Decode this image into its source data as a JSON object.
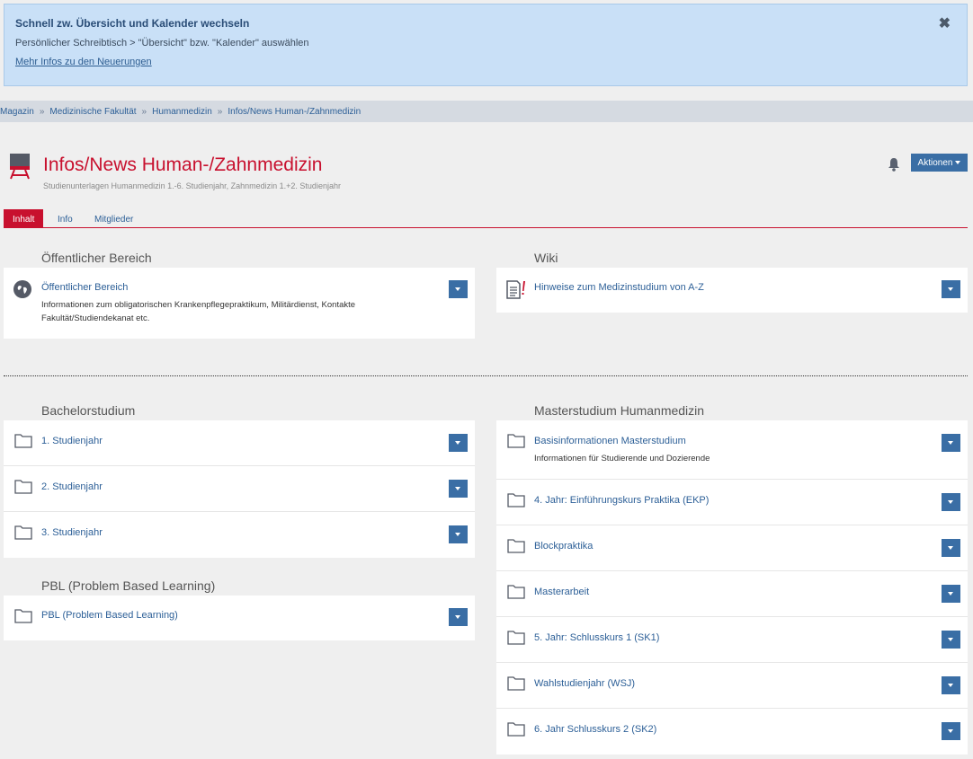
{
  "notice": {
    "title": "Schnell zw. Übersicht und Kalender wechseln",
    "text": "Persönlicher Schreibtisch > \"Übersicht\" bzw. \"Kalender\" auswählen",
    "link": "Mehr Infos zu den Neuerungen",
    "close": "✖"
  },
  "breadcrumb": [
    "Magazin",
    "Medizinische Fakultät",
    "Humanmedizin",
    "Infos/News Human-/Zahnmedizin"
  ],
  "breadcrumb_sep": "»",
  "header": {
    "title": "Infos/News Human-/Zahnmedizin",
    "subtitle": "Studienunterlagen Humanmedizin 1.-6. Studienjahr, Zahnmedizin 1.+2. Studienjahr",
    "actions_label": "Aktionen"
  },
  "tabs": [
    {
      "label": "Inhalt",
      "active": true
    },
    {
      "label": "Info",
      "active": false
    },
    {
      "label": "Mitglieder",
      "active": false
    }
  ],
  "sections": {
    "public": {
      "title": "Öffentlicher Bereich",
      "item_title": "Öffentlicher Bereich",
      "item_desc_1": "Informationen zum obligatorischen Krankenpflegepraktikum, Militärdienst, Kontakte",
      "item_desc_2": "Fakultät/Studiendekanat etc."
    },
    "wiki": {
      "title": "Wiki",
      "item_title": "Hinweise zum Medizinstudium von A-Z"
    },
    "bachelor": {
      "title": "Bachelorstudium",
      "items": [
        "1. Studienjahr",
        "2. Studienjahr",
        "3. Studienjahr"
      ]
    },
    "pbl": {
      "title": "PBL (Problem Based Learning)",
      "items": [
        "PBL (Problem Based Learning)"
      ]
    },
    "master": {
      "title": "Masterstudium Humanmedizin",
      "first_title": "Basisinformationen Masterstudium",
      "first_desc": "Informationen für Studierende und Dozierende",
      "items": [
        "4. Jahr: Einführungskurs Praktika (EKP)",
        "Blockpraktika",
        "Masterarbeit",
        "5. Jahr: Schlusskurs 1 (SK1)",
        "Wahlstudienjahr (WSJ)",
        "6. Jahr Schlusskurs 2 (SK2)"
      ]
    }
  },
  "colors": {
    "accent": "#c8102e",
    "button": "#3a6ea5",
    "link": "#2c5f97"
  }
}
